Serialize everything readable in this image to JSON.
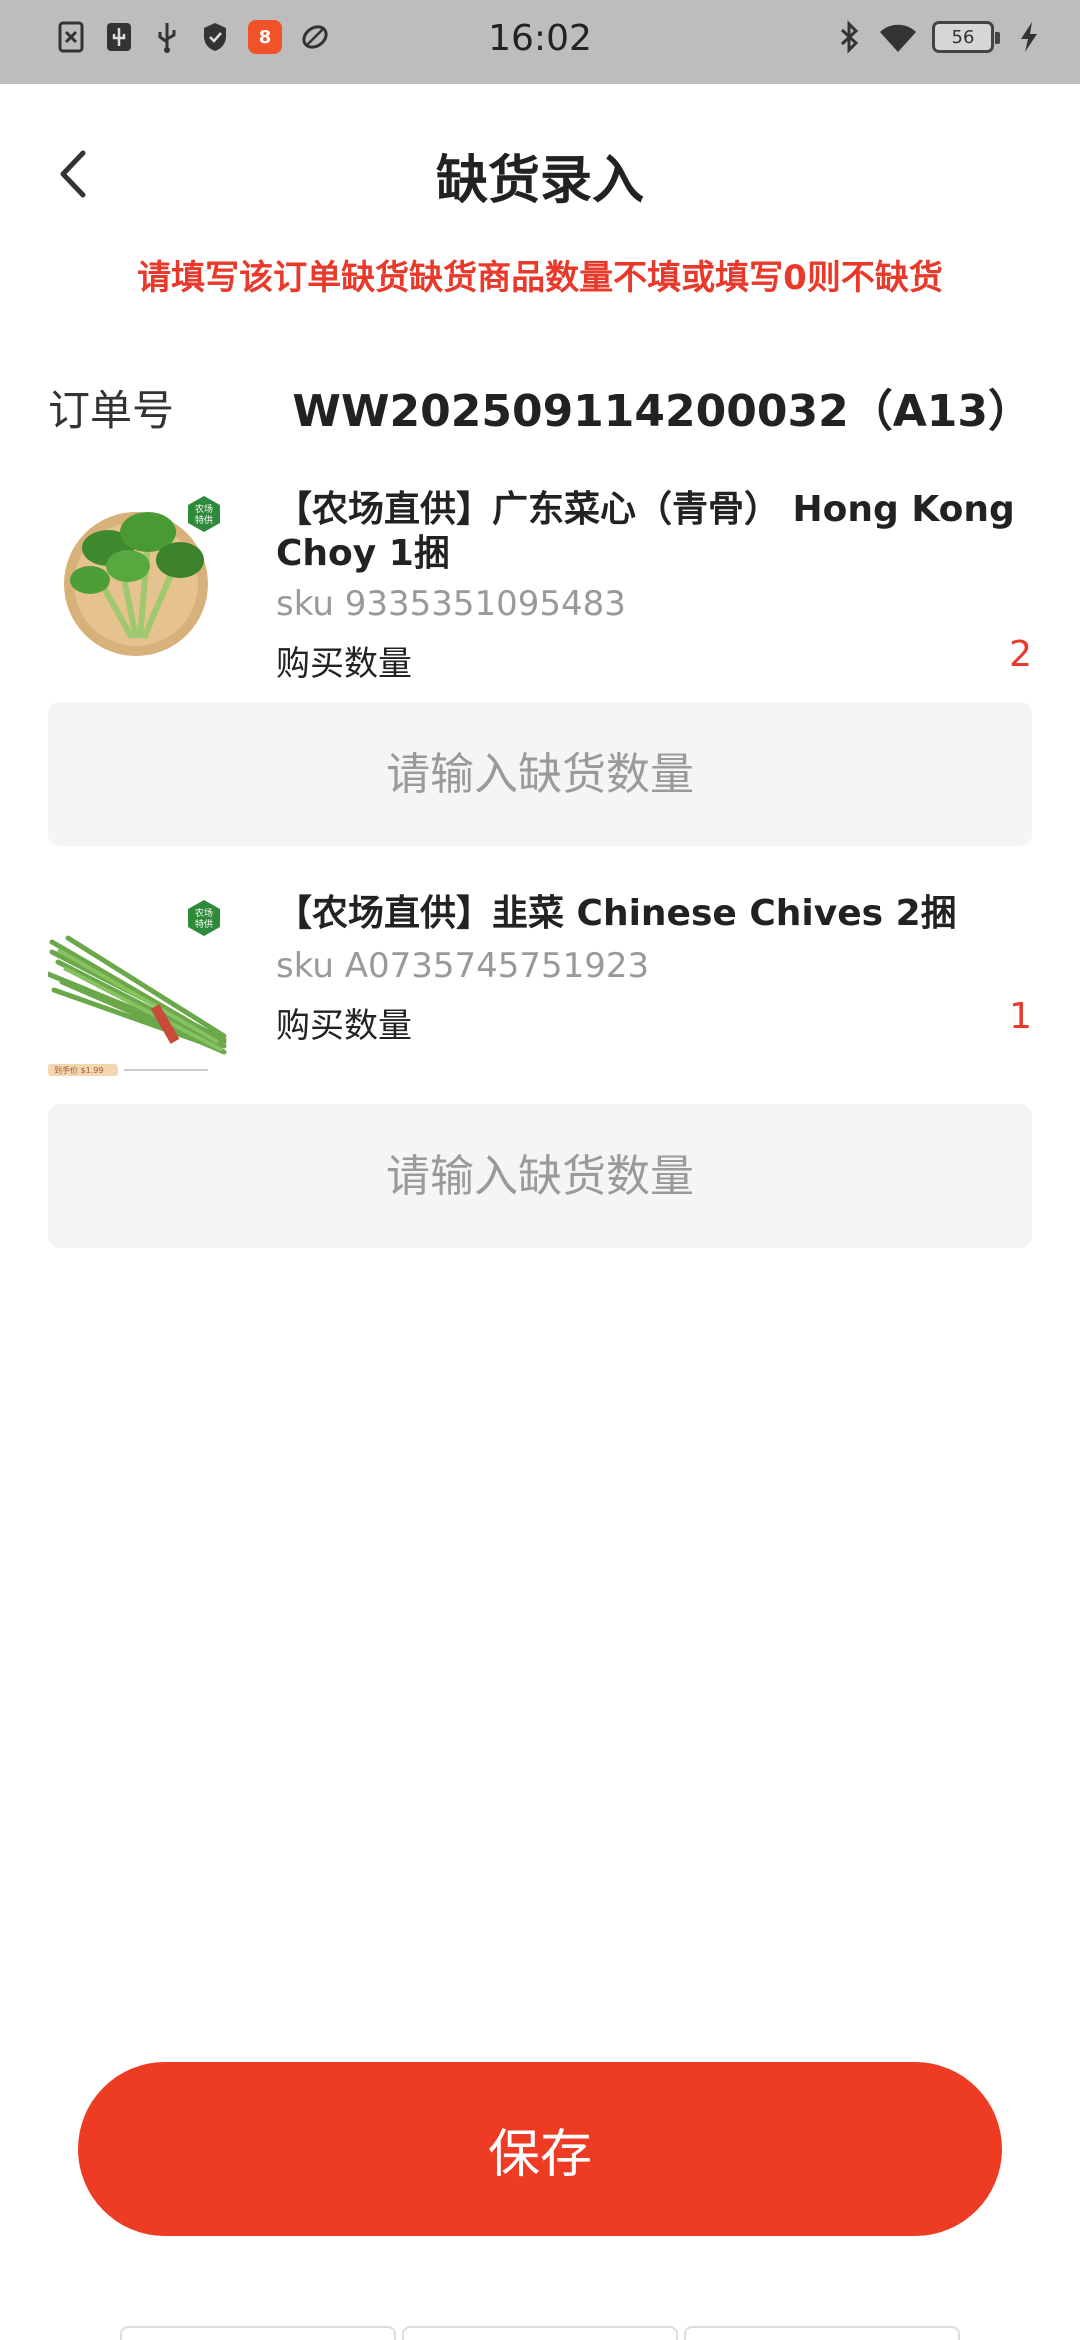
{
  "status_bar": {
    "time": "16:02",
    "battery": "56",
    "left_icons": [
      "sim-off-icon",
      "usb-debug-icon",
      "usb-icon",
      "shield-icon",
      "app-notification-icon",
      "leaf-icon"
    ],
    "right_icons": [
      "bluetooth-icon",
      "wifi-icon",
      "battery-icon",
      "charging-icon"
    ]
  },
  "header": {
    "title": "缺货录入"
  },
  "notice": "请填写该订单缺货缺货商品数量不填或填写0则不缺货",
  "order": {
    "label": "订单号",
    "value": "WW202509114200032（A13）"
  },
  "products": [
    {
      "name": "【农场直供】广东菜心（青骨） Hong Kong Choy 1捆",
      "sku": "sku 9335351095483",
      "qty_label": "购买数量",
      "qty_value": "2",
      "badge": "农场特供",
      "input_placeholder": "请输入缺货数量"
    },
    {
      "name": "【农场直供】韭菜 Chinese Chives 2捆",
      "sku": "sku A0735745751923",
      "qty_label": "购买数量",
      "qty_value": "1",
      "badge": "农场特供",
      "input_placeholder": "请输入缺货数量"
    }
  ],
  "save_label": "保存",
  "colors": {
    "accent": "#ee3b24",
    "notice": "#e8392a",
    "input_bg": "#f5f5f5",
    "status_bar": "#bdbdbd"
  }
}
